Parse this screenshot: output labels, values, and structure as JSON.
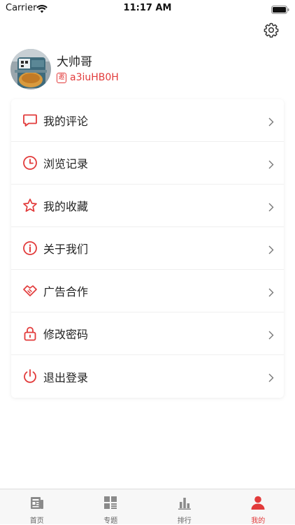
{
  "status_bar": {
    "carrier": "Carrier",
    "time": "11:17 AM"
  },
  "profile": {
    "username": "大帅哥",
    "id_badge": "邀",
    "invite_code": "a3iuHB0H"
  },
  "menu": {
    "items": [
      {
        "label": "我的评论",
        "icon": "comment-icon"
      },
      {
        "label": "浏览记录",
        "icon": "clock-icon"
      },
      {
        "label": "我的收藏",
        "icon": "star-icon"
      },
      {
        "label": "关于我们",
        "icon": "info-icon"
      },
      {
        "label": "广告合作",
        "icon": "handshake-icon"
      },
      {
        "label": "修改密码",
        "icon": "lock-icon"
      },
      {
        "label": "退出登录",
        "icon": "power-icon"
      }
    ]
  },
  "tabbar": {
    "tabs": [
      {
        "label": "首页",
        "icon": "news-icon"
      },
      {
        "label": "专题",
        "icon": "grid-icon"
      },
      {
        "label": "排行",
        "icon": "bar-chart-icon"
      },
      {
        "label": "我的",
        "icon": "person-icon"
      }
    ],
    "active_index": 3
  },
  "colors": {
    "accent": "#e23b3b",
    "icon_gray": "#8a8a8a",
    "text": "#222222"
  }
}
